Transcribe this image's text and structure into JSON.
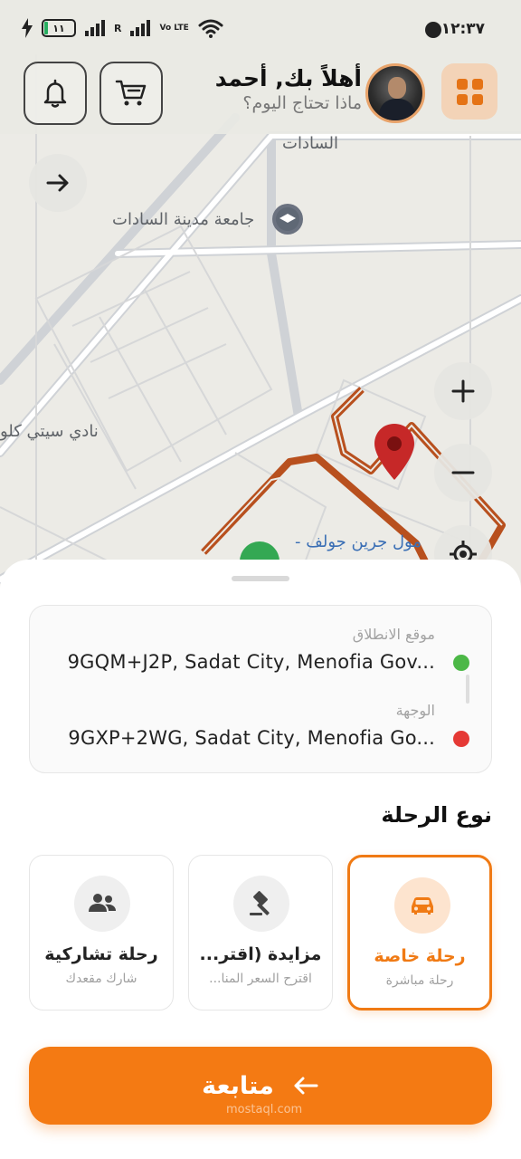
{
  "status_bar": {
    "battery": "١١",
    "network_r": "R",
    "volte": "Vo LTE",
    "time": "١٢:٣٧"
  },
  "header": {
    "greeting": "أهلاً بك, أحمد",
    "subtitle": "ماذا تحتاج اليوم؟"
  },
  "map": {
    "labels": {
      "sadat": "السادات",
      "university": "جامعة مدينة السادات",
      "club": "نادي سيتي كلو",
      "mall": "مول جرين جولف -"
    }
  },
  "route": {
    "pickup_label": "موقع الانطلاق",
    "pickup_value": "9GQM+J2P, Sadat City, Menofia Gov...",
    "destination_label": "الوجهة",
    "destination_value": "9GXP+2WG, Sadat City, Menofia Go...",
    "pickup_color": "#4cb847",
    "destination_color": "#e53935"
  },
  "trip_types": {
    "title": "نوع الرحلة",
    "options": [
      {
        "title": "رحلة خاصة",
        "subtitle": "رحلة مباشرة",
        "icon": "car-icon",
        "selected": true
      },
      {
        "title": "مزايدة (اقتر...",
        "subtitle": "اقترح السعر المنا...",
        "icon": "gavel-icon",
        "selected": false
      },
      {
        "title": "رحلة تشاركية",
        "subtitle": "شارك مقعدك",
        "icon": "group-icon",
        "selected": false
      }
    ]
  },
  "continue_label": "متابعة",
  "watermark": "mostaql.com",
  "colors": {
    "accent": "#f47a13",
    "route_line": "#b8501e"
  }
}
